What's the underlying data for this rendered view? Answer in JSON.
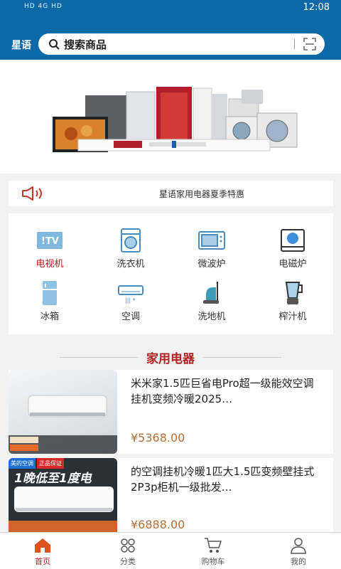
{
  "status": {
    "left": "HD 4G HD",
    "time": "12:08"
  },
  "header": {
    "brand": "星语",
    "search_placeholder": "搜索商品"
  },
  "notice": {
    "text": "星语家用电器夏季特惠"
  },
  "categories": [
    {
      "label": "电视机",
      "icon": "tv-icon"
    },
    {
      "label": "洗衣机",
      "icon": "washing-machine-icon"
    },
    {
      "label": "微波炉",
      "icon": "microwave-icon"
    },
    {
      "label": "电磁炉",
      "icon": "induction-cooker-icon"
    },
    {
      "label": "冰箱",
      "icon": "fridge-icon"
    },
    {
      "label": "空调",
      "icon": "air-conditioner-icon"
    },
    {
      "label": "洗地机",
      "icon": "floor-washer-icon"
    },
    {
      "label": "榨汁机",
      "icon": "juicer-icon"
    }
  ],
  "section_title": "家用电器",
  "products": [
    {
      "title": "米米家1.5匹巨省电Pro超一级能效空调挂机变频冷暖2025…",
      "price": "¥5368.00"
    },
    {
      "title": "的空调挂机冷暖1匹大1.5匹变频壁挂式2P3p柜机一级批发…",
      "price": "¥6888.00",
      "img_text": "1晚低至1度电",
      "badge1": "美的空调",
      "badge2": "正品保证"
    }
  ],
  "tabs": [
    {
      "label": "首页",
      "icon": "home-icon"
    },
    {
      "label": "分类",
      "icon": "category-icon"
    },
    {
      "label": "购物车",
      "icon": "cart-icon"
    },
    {
      "label": "我的",
      "icon": "user-icon"
    }
  ],
  "colors": {
    "brand_blue": "#0a69a6",
    "accent_red": "#b32222",
    "price": "#b5703a"
  }
}
